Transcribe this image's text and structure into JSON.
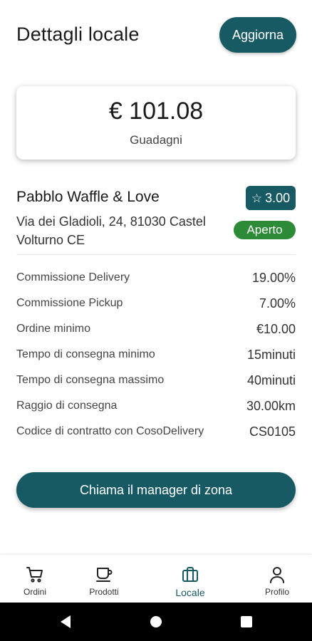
{
  "header": {
    "title": "Dettagli locale",
    "refresh_label": "Aggiorna"
  },
  "earnings": {
    "amount": "€ 101.08",
    "label": "Guadagni"
  },
  "store": {
    "name": "Pabblo Waffle & Love",
    "address": "Via dei Gladioli, 24, 81030 Castel Volturno CE",
    "rating": "3.00",
    "status": "Aperto"
  },
  "details": [
    {
      "label": "Commissione Delivery",
      "value": "19.00%"
    },
    {
      "label": "Commissione Pickup",
      "value": "7.00%"
    },
    {
      "label": "Ordine minimo",
      "value": "€10.00"
    },
    {
      "label": "Tempo di consegna minimo",
      "value": "15minuti"
    },
    {
      "label": "Tempo di consegna massimo",
      "value": "40minuti"
    },
    {
      "label": "Raggio di consegna",
      "value": "30.00km"
    },
    {
      "label": "Codice di contratto con CosoDelivery",
      "value": "CS0105"
    }
  ],
  "call_button_label": "Chiama il manager di zona",
  "nav": {
    "items": [
      {
        "label": "Ordini",
        "icon": "cart-icon"
      },
      {
        "label": "Prodotti",
        "icon": "coffee-cup-icon"
      },
      {
        "label": "Locale",
        "icon": "briefcase-icon",
        "active": true
      },
      {
        "label": "Profilo",
        "icon": "person-icon"
      }
    ]
  },
  "system_bar": {
    "buttons": [
      "back-icon",
      "home-icon",
      "recents-icon"
    ]
  },
  "colors": {
    "primary": "#175a63",
    "status_open": "#2d8a36"
  }
}
